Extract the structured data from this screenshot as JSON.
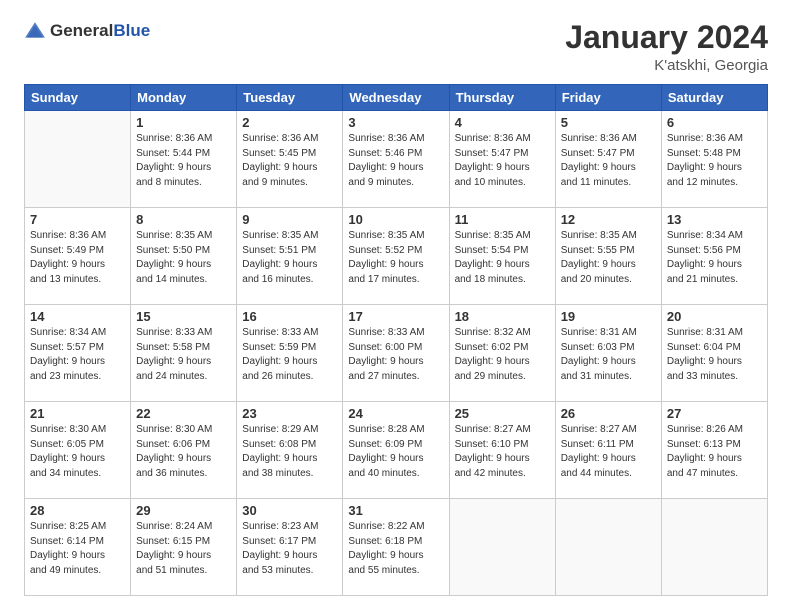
{
  "header": {
    "logo_general": "General",
    "logo_blue": "Blue",
    "month_title": "January 2024",
    "location": "K'atskhi, Georgia"
  },
  "weekdays": [
    "Sunday",
    "Monday",
    "Tuesday",
    "Wednesday",
    "Thursday",
    "Friday",
    "Saturday"
  ],
  "weeks": [
    [
      {
        "day": "",
        "sunrise": "",
        "sunset": "",
        "daylight": ""
      },
      {
        "day": "1",
        "sunrise": "Sunrise: 8:36 AM",
        "sunset": "Sunset: 5:44 PM",
        "daylight": "Daylight: 9 hours and 8 minutes."
      },
      {
        "day": "2",
        "sunrise": "Sunrise: 8:36 AM",
        "sunset": "Sunset: 5:45 PM",
        "daylight": "Daylight: 9 hours and 9 minutes."
      },
      {
        "day": "3",
        "sunrise": "Sunrise: 8:36 AM",
        "sunset": "Sunset: 5:46 PM",
        "daylight": "Daylight: 9 hours and 9 minutes."
      },
      {
        "day": "4",
        "sunrise": "Sunrise: 8:36 AM",
        "sunset": "Sunset: 5:47 PM",
        "daylight": "Daylight: 9 hours and 10 minutes."
      },
      {
        "day": "5",
        "sunrise": "Sunrise: 8:36 AM",
        "sunset": "Sunset: 5:47 PM",
        "daylight": "Daylight: 9 hours and 11 minutes."
      },
      {
        "day": "6",
        "sunrise": "Sunrise: 8:36 AM",
        "sunset": "Sunset: 5:48 PM",
        "daylight": "Daylight: 9 hours and 12 minutes."
      }
    ],
    [
      {
        "day": "7",
        "sunrise": "Sunrise: 8:36 AM",
        "sunset": "Sunset: 5:49 PM",
        "daylight": "Daylight: 9 hours and 13 minutes."
      },
      {
        "day": "8",
        "sunrise": "Sunrise: 8:35 AM",
        "sunset": "Sunset: 5:50 PM",
        "daylight": "Daylight: 9 hours and 14 minutes."
      },
      {
        "day": "9",
        "sunrise": "Sunrise: 8:35 AM",
        "sunset": "Sunset: 5:51 PM",
        "daylight": "Daylight: 9 hours and 16 minutes."
      },
      {
        "day": "10",
        "sunrise": "Sunrise: 8:35 AM",
        "sunset": "Sunset: 5:52 PM",
        "daylight": "Daylight: 9 hours and 17 minutes."
      },
      {
        "day": "11",
        "sunrise": "Sunrise: 8:35 AM",
        "sunset": "Sunset: 5:54 PM",
        "daylight": "Daylight: 9 hours and 18 minutes."
      },
      {
        "day": "12",
        "sunrise": "Sunrise: 8:35 AM",
        "sunset": "Sunset: 5:55 PM",
        "daylight": "Daylight: 9 hours and 20 minutes."
      },
      {
        "day": "13",
        "sunrise": "Sunrise: 8:34 AM",
        "sunset": "Sunset: 5:56 PM",
        "daylight": "Daylight: 9 hours and 21 minutes."
      }
    ],
    [
      {
        "day": "14",
        "sunrise": "Sunrise: 8:34 AM",
        "sunset": "Sunset: 5:57 PM",
        "daylight": "Daylight: 9 hours and 23 minutes."
      },
      {
        "day": "15",
        "sunrise": "Sunrise: 8:33 AM",
        "sunset": "Sunset: 5:58 PM",
        "daylight": "Daylight: 9 hours and 24 minutes."
      },
      {
        "day": "16",
        "sunrise": "Sunrise: 8:33 AM",
        "sunset": "Sunset: 5:59 PM",
        "daylight": "Daylight: 9 hours and 26 minutes."
      },
      {
        "day": "17",
        "sunrise": "Sunrise: 8:33 AM",
        "sunset": "Sunset: 6:00 PM",
        "daylight": "Daylight: 9 hours and 27 minutes."
      },
      {
        "day": "18",
        "sunrise": "Sunrise: 8:32 AM",
        "sunset": "Sunset: 6:02 PM",
        "daylight": "Daylight: 9 hours and 29 minutes."
      },
      {
        "day": "19",
        "sunrise": "Sunrise: 8:31 AM",
        "sunset": "Sunset: 6:03 PM",
        "daylight": "Daylight: 9 hours and 31 minutes."
      },
      {
        "day": "20",
        "sunrise": "Sunrise: 8:31 AM",
        "sunset": "Sunset: 6:04 PM",
        "daylight": "Daylight: 9 hours and 33 minutes."
      }
    ],
    [
      {
        "day": "21",
        "sunrise": "Sunrise: 8:30 AM",
        "sunset": "Sunset: 6:05 PM",
        "daylight": "Daylight: 9 hours and 34 minutes."
      },
      {
        "day": "22",
        "sunrise": "Sunrise: 8:30 AM",
        "sunset": "Sunset: 6:06 PM",
        "daylight": "Daylight: 9 hours and 36 minutes."
      },
      {
        "day": "23",
        "sunrise": "Sunrise: 8:29 AM",
        "sunset": "Sunset: 6:08 PM",
        "daylight": "Daylight: 9 hours and 38 minutes."
      },
      {
        "day": "24",
        "sunrise": "Sunrise: 8:28 AM",
        "sunset": "Sunset: 6:09 PM",
        "daylight": "Daylight: 9 hours and 40 minutes."
      },
      {
        "day": "25",
        "sunrise": "Sunrise: 8:27 AM",
        "sunset": "Sunset: 6:10 PM",
        "daylight": "Daylight: 9 hours and 42 minutes."
      },
      {
        "day": "26",
        "sunrise": "Sunrise: 8:27 AM",
        "sunset": "Sunset: 6:11 PM",
        "daylight": "Daylight: 9 hours and 44 minutes."
      },
      {
        "day": "27",
        "sunrise": "Sunrise: 8:26 AM",
        "sunset": "Sunset: 6:13 PM",
        "daylight": "Daylight: 9 hours and 47 minutes."
      }
    ],
    [
      {
        "day": "28",
        "sunrise": "Sunrise: 8:25 AM",
        "sunset": "Sunset: 6:14 PM",
        "daylight": "Daylight: 9 hours and 49 minutes."
      },
      {
        "day": "29",
        "sunrise": "Sunrise: 8:24 AM",
        "sunset": "Sunset: 6:15 PM",
        "daylight": "Daylight: 9 hours and 51 minutes."
      },
      {
        "day": "30",
        "sunrise": "Sunrise: 8:23 AM",
        "sunset": "Sunset: 6:17 PM",
        "daylight": "Daylight: 9 hours and 53 minutes."
      },
      {
        "day": "31",
        "sunrise": "Sunrise: 8:22 AM",
        "sunset": "Sunset: 6:18 PM",
        "daylight": "Daylight: 9 hours and 55 minutes."
      },
      {
        "day": "",
        "sunrise": "",
        "sunset": "",
        "daylight": ""
      },
      {
        "day": "",
        "sunrise": "",
        "sunset": "",
        "daylight": ""
      },
      {
        "day": "",
        "sunrise": "",
        "sunset": "",
        "daylight": ""
      }
    ]
  ]
}
